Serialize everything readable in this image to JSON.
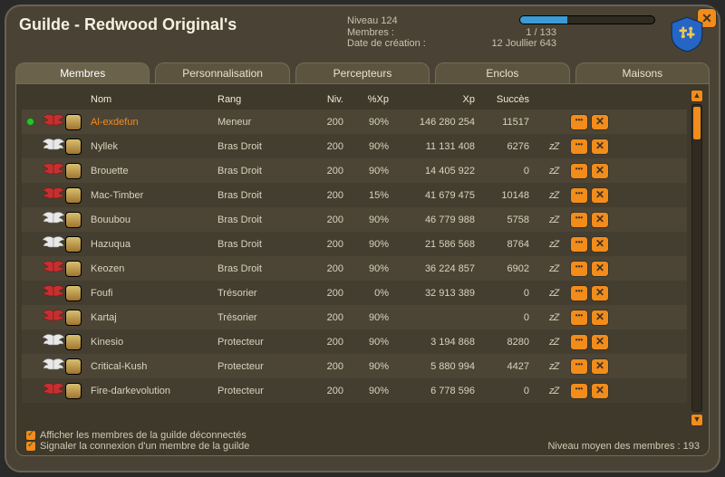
{
  "header": {
    "title": "Guilde - Redwood Original's",
    "level_label": "Niveau",
    "level_value": "124",
    "members_label": "Membres :",
    "members_value": "1 / 133",
    "created_label": "Date de création :",
    "created_value": "12 Joullier 643"
  },
  "tabs": [
    "Membres",
    "Personnalisation",
    "Percepteurs",
    "Enclos",
    "Maisons"
  ],
  "columns": {
    "name": "Nom",
    "rank": "Rang",
    "level": "Niv.",
    "pxp": "%Xp",
    "xp": "Xp",
    "succ": "Succès"
  },
  "members": [
    {
      "online": true,
      "wings": "red",
      "name": "Al-exdefun",
      "link": true,
      "rank": "Meneur",
      "level": 200,
      "pxp": "90%",
      "xp": "146 280 254",
      "succ": "11517",
      "zz": false
    },
    {
      "online": false,
      "wings": "white",
      "name": "Nyllek",
      "link": false,
      "rank": "Bras Droit",
      "level": 200,
      "pxp": "90%",
      "xp": "11 131 408",
      "succ": "6276",
      "zz": true
    },
    {
      "online": false,
      "wings": "red",
      "name": "Brouette",
      "link": false,
      "rank": "Bras Droit",
      "level": 200,
      "pxp": "90%",
      "xp": "14 405 922",
      "succ": "0",
      "zz": true
    },
    {
      "online": false,
      "wings": "red",
      "name": "Mac-Timber",
      "link": false,
      "rank": "Bras Droit",
      "level": 200,
      "pxp": "15%",
      "xp": "41 679 475",
      "succ": "10148",
      "zz": true
    },
    {
      "online": false,
      "wings": "white",
      "name": "Bouubou",
      "link": false,
      "rank": "Bras Droit",
      "level": 200,
      "pxp": "90%",
      "xp": "46 779 988",
      "succ": "5758",
      "zz": true
    },
    {
      "online": false,
      "wings": "white",
      "name": "Hazuqua",
      "link": false,
      "rank": "Bras Droit",
      "level": 200,
      "pxp": "90%",
      "xp": "21 586 568",
      "succ": "8764",
      "zz": true
    },
    {
      "online": false,
      "wings": "red",
      "name": "Keozen",
      "link": false,
      "rank": "Bras Droit",
      "level": 200,
      "pxp": "90%",
      "xp": "36 224 857",
      "succ": "6902",
      "zz": true
    },
    {
      "online": false,
      "wings": "red",
      "name": "Foufi",
      "link": false,
      "rank": "Trésorier",
      "level": 200,
      "pxp": "0%",
      "xp": "32 913 389",
      "succ": "0",
      "zz": true
    },
    {
      "online": false,
      "wings": "red",
      "name": "Kartaj",
      "link": false,
      "rank": "Trésorier",
      "level": 200,
      "pxp": "90%",
      "xp": "",
      "succ": "0",
      "zz": true
    },
    {
      "online": false,
      "wings": "white",
      "name": "Kinesio",
      "link": false,
      "rank": "Protecteur",
      "level": 200,
      "pxp": "90%",
      "xp": "3 194 868",
      "succ": "8280",
      "zz": true
    },
    {
      "online": false,
      "wings": "white",
      "name": "Critical-Kush",
      "link": false,
      "rank": "Protecteur",
      "level": 200,
      "pxp": "90%",
      "xp": "5 880 994",
      "succ": "4427",
      "zz": true
    },
    {
      "online": false,
      "wings": "red",
      "name": "Fire-darkevolution",
      "link": false,
      "rank": "Protecteur",
      "level": 200,
      "pxp": "90%",
      "xp": "6 778 596",
      "succ": "0",
      "zz": true
    }
  ],
  "footer": {
    "show_offline": "Afficher les membres de la guilde déconnectés",
    "notify_login": "Signaler la connexion d'un membre de la guilde",
    "avg_label": "Niveau moyen des membres :",
    "avg_value": "193"
  }
}
